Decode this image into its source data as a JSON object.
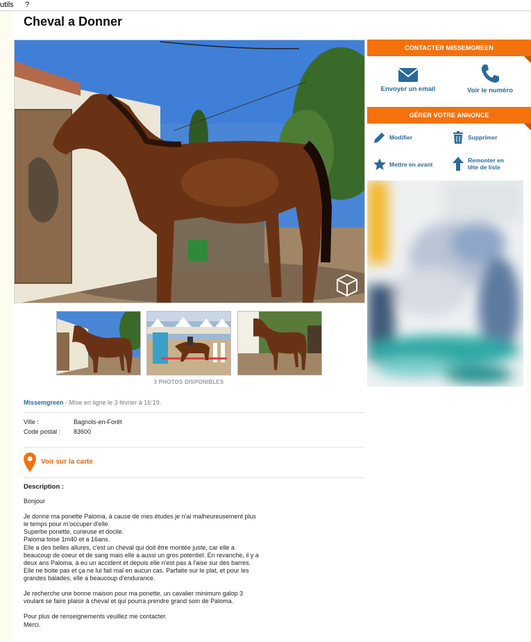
{
  "menubar": {
    "tools": "utils",
    "help": "?"
  },
  "listing": {
    "title": "Cheval a Donner",
    "photos_count": "3 PHOTOS DISPONIBLES",
    "seller": "Missemgreen",
    "posted": " - Mise en ligne le 3 février à 16:19.",
    "city_label": "Ville :",
    "city": "Bagnols-en-Forêt",
    "postal_label": "Code postal :",
    "postal": "83600",
    "map_link": "Voir sur la carte",
    "description_title": "Description :",
    "description": "Bonjour\n\nJe donne ma ponette Paloma, à cause de mes études je n'ai malheureusement plus le temps pour m'occuper d'elle.\nSuperbe ponette, curieuse et docile.\nPaloma toise 1m40 et a 16ans.\nElle a des belles allures, c'est un cheval qui doit être montée juste, car elle a beaucoup de coeur et de sang mais elle a aussi un gros potentiel. En revanche, il y a deux ans Paloma, à eu un accident et depuis elle n'est pas à l'aise sur des barres. Elle ne boite pas et ça ne lui fait mal en aucun cas. Parfaite sur le plat, et pour les grandes balades, elle a beaucoup d'endurance.\n\nJe recherche une bonne maison pour ma ponette, un cavalier minimum galop 3 voulant se faire plaisir à cheval et qui pourra prendre grand soin de Paloma.\n\nPour plus de renseignements veuillez me contacter.\nMerci."
  },
  "sidebar": {
    "contact_header": "CONTACTER MISSEMGREEN",
    "email_label": "Envoyer un email",
    "phone_label": "Voir le numéro",
    "manage_header": "GÉRER VOTRE ANNONCE",
    "edit_label": "Modifier",
    "delete_label": "Supprimer",
    "feature_label": "Mettre en avant",
    "bump_label_1": "Remonter en",
    "bump_label_2": "tête de liste"
  },
  "colors": {
    "accent_orange": "#f3720e",
    "link_blue": "#2a6a9a",
    "map_orange": "#e06a10"
  }
}
